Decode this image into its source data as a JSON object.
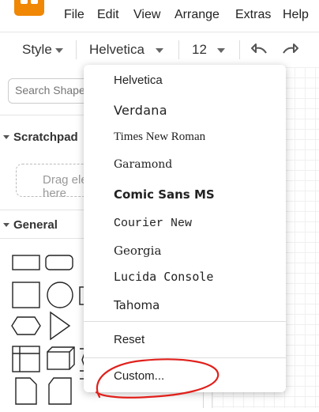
{
  "menubar": {
    "items": [
      "File",
      "Edit",
      "View",
      "Arrange",
      "Extras",
      "Help"
    ]
  },
  "toolbar": {
    "style_label": "Style",
    "font_label": "Helvetica",
    "size_label": "12"
  },
  "sidebar": {
    "search_placeholder": "Search Shapes",
    "scratchpad_label": "Scratchpad",
    "drag_hint": "Drag elements here",
    "general_label": "General"
  },
  "font_menu": {
    "options": [
      "Helvetica",
      "Verdana",
      "Times New Roman",
      "Garamond",
      "Comic Sans MS",
      "Courier New",
      "Georgia",
      "Lucida Console",
      "Tahoma"
    ],
    "reset_label": "Reset",
    "custom_label": "Custom..."
  },
  "annotation": {
    "color": "#e0201b"
  },
  "colors": {
    "brand": "#f08705"
  },
  "icons": [
    "app-logo-icon",
    "caret-down-icon",
    "undo-icon",
    "redo-icon",
    "disclosure-triangle-icon"
  ]
}
